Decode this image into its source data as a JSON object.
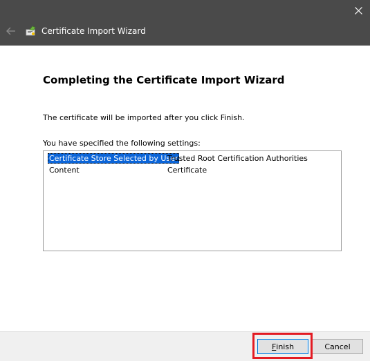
{
  "window": {
    "title": "Certificate Import Wizard",
    "close_icon": "close-icon",
    "back_icon": "back-arrow-icon"
  },
  "content": {
    "heading": "Completing the Certificate Import Wizard",
    "description": "The certificate will be imported after you click Finish.",
    "settings_label": "You have specified the following settings:",
    "settings": [
      {
        "key": "Certificate Store Selected by User",
        "value": "Trusted Root Certification Authorities",
        "selected": true
      },
      {
        "key": "Content",
        "value": "Certificate",
        "selected": false
      }
    ]
  },
  "footer": {
    "finish_label_underlined": "F",
    "finish_label_rest": "inish",
    "cancel_label": "Cancel"
  },
  "colors": {
    "titlebar": "#4a4a4a",
    "selection": "#0a64d8",
    "highlight_box": "#e31b23"
  }
}
